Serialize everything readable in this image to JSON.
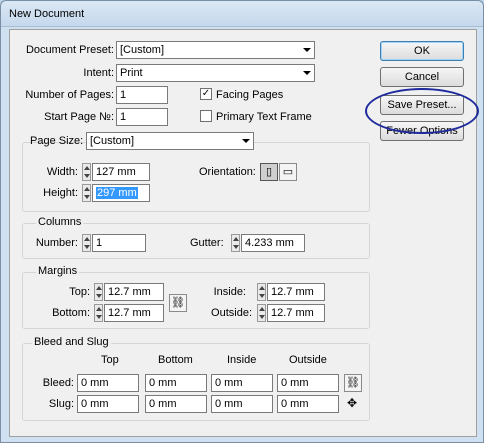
{
  "window": {
    "title": "New Document"
  },
  "preset": {
    "label": "Document Preset:",
    "value": "[Custom]"
  },
  "intent": {
    "label": "Intent:",
    "value": "Print"
  },
  "num_pages": {
    "label": "Number of Pages:",
    "value": "1"
  },
  "start_page": {
    "label": "Start Page №:",
    "value": "1"
  },
  "facing_pages": {
    "label": "Facing Pages",
    "checked": true,
    "mark": "✓"
  },
  "primary_text_frame": {
    "label": "Primary Text Frame",
    "checked": false
  },
  "page_size": {
    "label": "Page Size:",
    "value": "[Custom]"
  },
  "width": {
    "label": "Width:",
    "value": "127 mm"
  },
  "height": {
    "label": "Height:",
    "value": "297 mm"
  },
  "orientation": {
    "label": "Orientation:",
    "selected": "portrait",
    "portrait_glyph": "▯",
    "landscape_glyph": "▭"
  },
  "columns": {
    "title": "Columns",
    "number_label": "Number:",
    "number_value": "1",
    "gutter_label": "Gutter:",
    "gutter_value": "4.233 mm"
  },
  "margins": {
    "title": "Margins",
    "top_label": "Top:",
    "top_value": "12.7 mm",
    "bottom_label": "Bottom:",
    "bottom_value": "12.7 mm",
    "inside_label": "Inside:",
    "inside_value": "12.7 mm",
    "outside_label": "Outside:",
    "outside_value": "12.7 mm",
    "link_glyph": "⛓"
  },
  "bleed_slug": {
    "title": "Bleed and Slug",
    "headers": [
      "Top",
      "Bottom",
      "Inside",
      "Outside"
    ],
    "bleed_label": "Bleed:",
    "bleed_values": [
      "0 mm",
      "0 mm",
      "0 mm",
      "0 mm"
    ],
    "slug_label": "Slug:",
    "slug_values": [
      "0 mm",
      "0 mm",
      "0 mm",
      "0 mm"
    ],
    "link_glyph": "⛓",
    "unlink_glyph": "✥"
  },
  "buttons": {
    "ok": "OK",
    "cancel": "Cancel",
    "save_preset": "Save Preset...",
    "fewer_options": "Fewer Options"
  }
}
